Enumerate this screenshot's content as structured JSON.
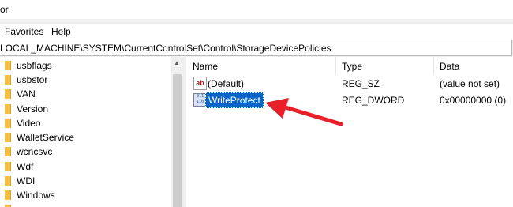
{
  "window": {
    "title_fragment": "or"
  },
  "menu": {
    "favorites": "Favorites",
    "help": "Help"
  },
  "address": {
    "path": "LOCAL_MACHINE\\SYSTEM\\CurrentControlSet\\Control\\StorageDevicePolicies"
  },
  "tree": {
    "items": [
      {
        "label": "usbflags"
      },
      {
        "label": "usbstor"
      },
      {
        "label": "VAN"
      },
      {
        "label": "Version"
      },
      {
        "label": "Video"
      },
      {
        "label": "WalletService"
      },
      {
        "label": "wcncsvc"
      },
      {
        "label": "Wdf"
      },
      {
        "label": "WDI"
      },
      {
        "label": "Windows"
      }
    ]
  },
  "list": {
    "headers": {
      "name": "Name",
      "type": "Type",
      "data": "Data"
    },
    "rows": [
      {
        "name": "(Default)",
        "type": "REG_SZ",
        "data": "(value not set)",
        "icon": "string-value-icon"
      },
      {
        "name": "WriteProtect",
        "type": "REG_DWORD",
        "data": "0x00000000 (0)",
        "icon": "binary-value-icon",
        "selected": true
      }
    ]
  },
  "annotation": {
    "arrow_color": "#e8202a"
  }
}
